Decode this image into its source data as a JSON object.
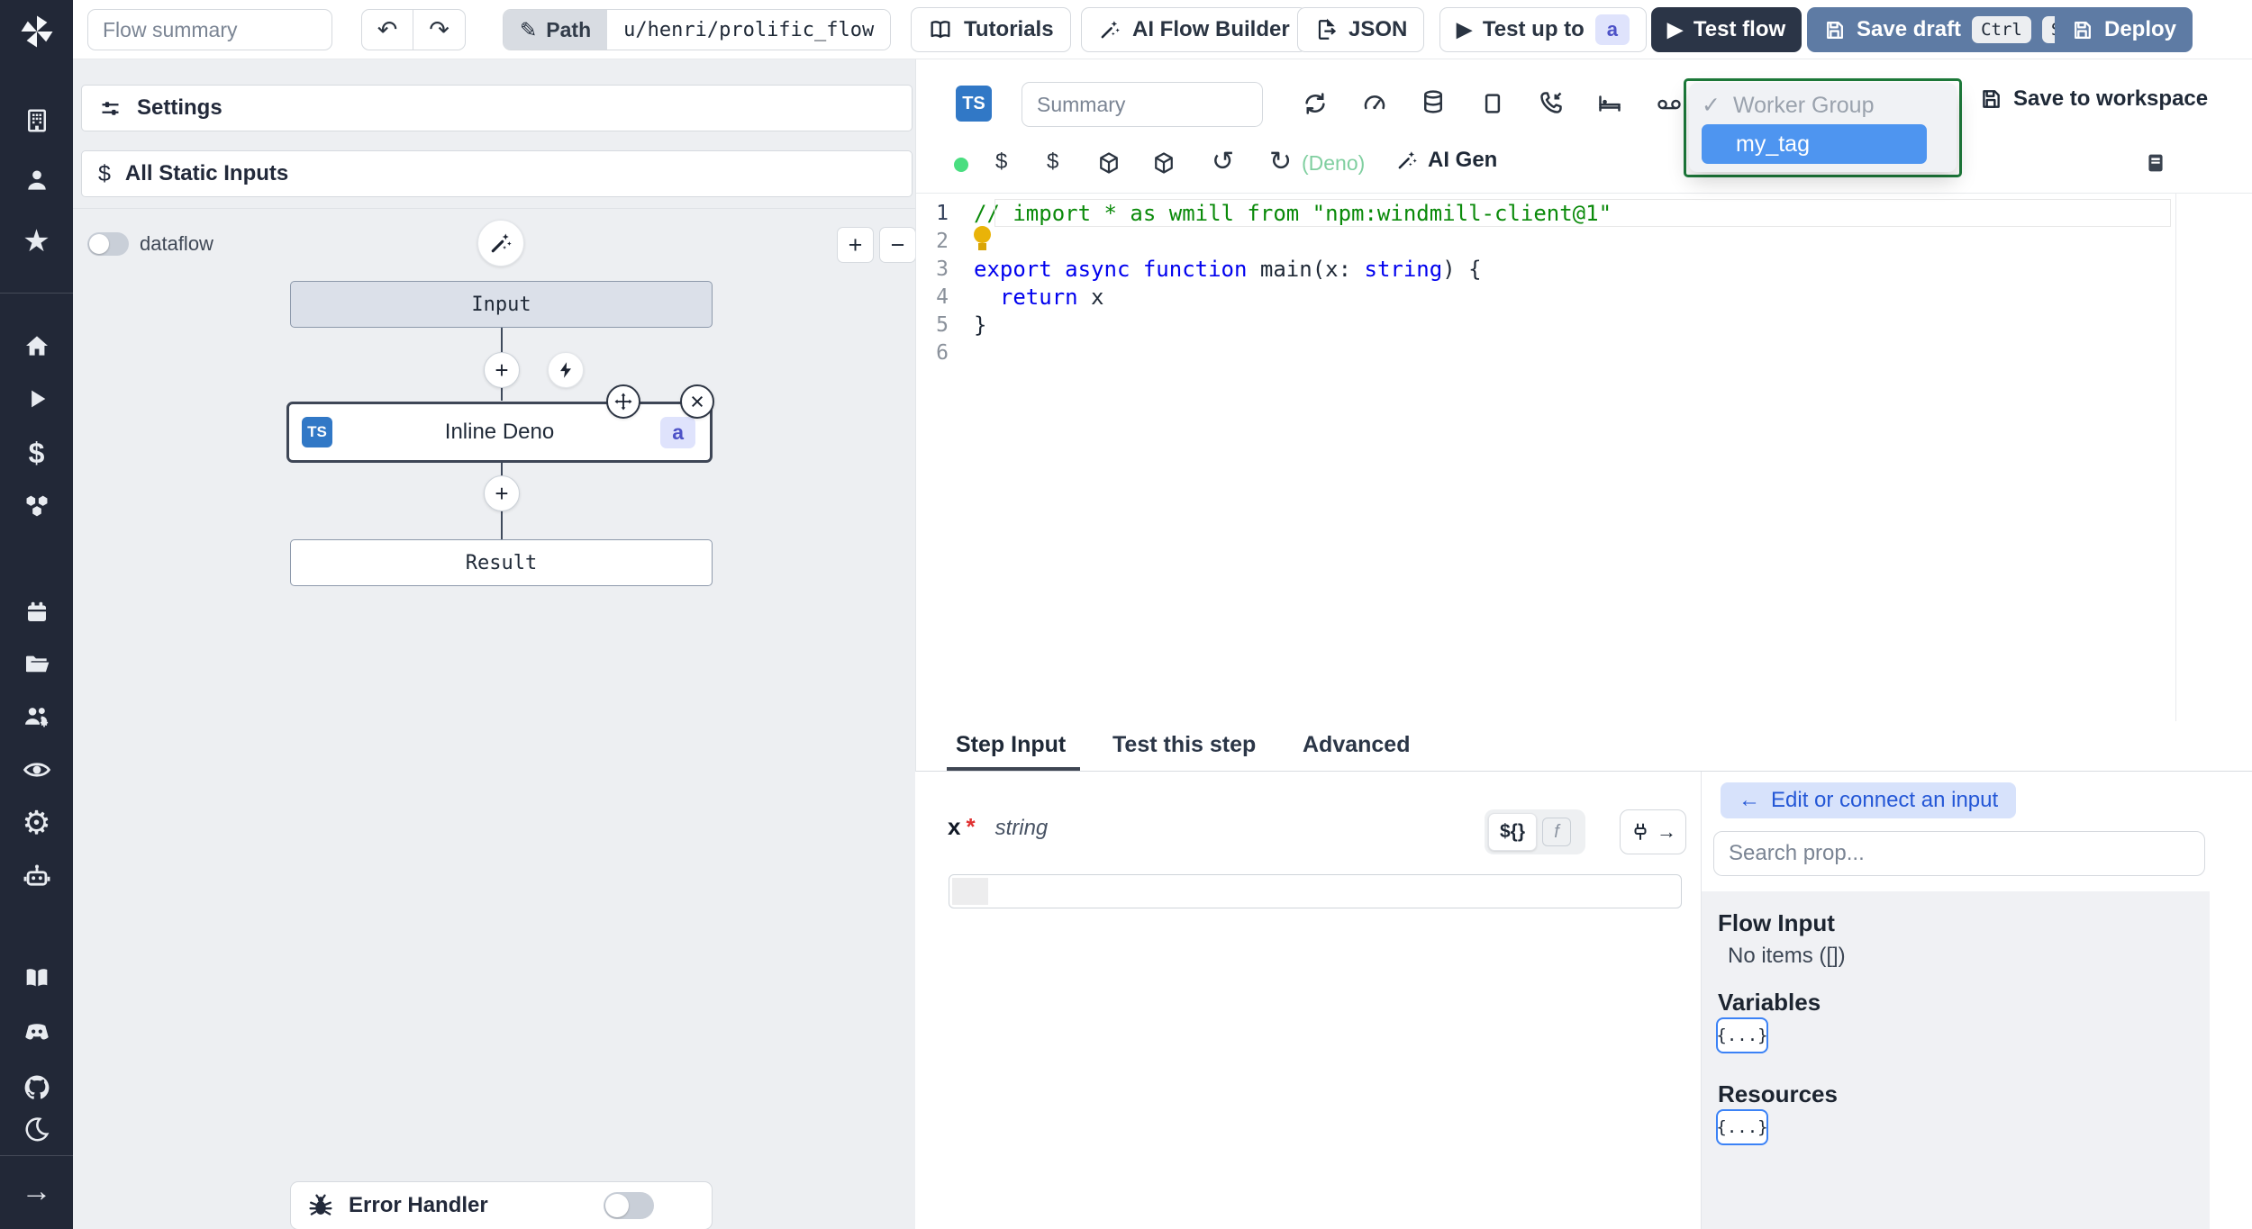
{
  "topbar": {
    "flow_summary_placeholder": "Flow summary",
    "path_label": "Path",
    "path_value": "u/henri/prolific_flow",
    "tutorials_label": "Tutorials",
    "ai_flow_builder_label": "AI Flow Builder",
    "json_label": "JSON",
    "test_up_to_label": "Test up to",
    "test_up_to_badge": "a",
    "test_flow_label": "Test flow",
    "save_draft_label": "Save draft",
    "kbd_ctrl": "Ctrl",
    "kbd_s": "S",
    "deploy_label": "Deploy"
  },
  "sidebar": {
    "icon_names": [
      "windmill-logo",
      "workspace-building",
      "user",
      "favorites-star",
      "home",
      "runs-play",
      "variables-dollar",
      "resources-cubes",
      "schedules-calendar",
      "folders",
      "groups-users-gear",
      "audit-eye",
      "settings-gear",
      "ai-robot",
      "docs-book",
      "discord",
      "github",
      "dark-mode-moon",
      "collapse-arrow"
    ]
  },
  "flow_panel": {
    "settings_label": "Settings",
    "static_inputs_label": "All Static Inputs",
    "static_inputs_icon": "$",
    "dataflow_label": "dataflow",
    "zoom_in": "+",
    "zoom_out": "−",
    "error_handler_label": "Error Handler"
  },
  "graph": {
    "input_node": "Input",
    "step_node": {
      "lang_badge": "TS",
      "title": "Inline Deno",
      "tag_badge": "a"
    },
    "result_node": "Result",
    "plus": "+",
    "close": "×"
  },
  "editor": {
    "lang_badge": "TS",
    "summary_placeholder": "Summary",
    "deno_label": "(Deno)",
    "ai_gen_label": "AI Gen",
    "save_to_workspace_label": "Save to workspace",
    "dollar_icon": "$",
    "history_icon": "↺",
    "refresh_icon": "↻",
    "dropdown": {
      "check": "✓",
      "group_label": "Worker Group",
      "selected": "my_tag"
    },
    "code": {
      "lines": [
        {
          "ln": "1",
          "active": true,
          "tokens": [
            {
              "c": "comment",
              "s": "// import * as wmill from \"npm:windmill-client@1\""
            }
          ]
        },
        {
          "ln": "2",
          "bulb": true,
          "tokens": []
        },
        {
          "ln": "3",
          "tokens": [
            {
              "c": "kw",
              "s": "export"
            },
            {
              "c": "plain",
              "s": " "
            },
            {
              "c": "kw",
              "s": "async"
            },
            {
              "c": "plain",
              "s": " "
            },
            {
              "c": "kw",
              "s": "function"
            },
            {
              "c": "plain",
              "s": " main(x: "
            },
            {
              "c": "type",
              "s": "string"
            },
            {
              "c": "plain",
              "s": ") {"
            }
          ]
        },
        {
          "ln": "4",
          "tokens": [
            {
              "c": "plain",
              "s": "  "
            },
            {
              "c": "kw",
              "s": "return"
            },
            {
              "c": "plain",
              "s": " x"
            }
          ]
        },
        {
          "ln": "5",
          "tokens": [
            {
              "c": "plain",
              "s": "}"
            }
          ]
        },
        {
          "ln": "6",
          "tokens": []
        }
      ]
    }
  },
  "tabs": {
    "items": [
      {
        "label": "Step Input"
      },
      {
        "label": "Test this step"
      },
      {
        "label": "Advanced"
      }
    ],
    "active": "Step Input"
  },
  "step_input": {
    "field_name": "x",
    "required_mark": "*",
    "field_type": "string",
    "expr_toggle": "${}",
    "fn_toggle": "f",
    "connect_arrow": "→"
  },
  "right_panel": {
    "back_arrow": "←",
    "edit_connect_label": "Edit or connect an input",
    "search_placeholder": "Search prop...",
    "flow_input_label": "Flow Input",
    "no_items_label": "No items ([])",
    "variables_label": "Variables",
    "resources_label": "Resources",
    "braces_chip": "{...}"
  },
  "icons_unicode": {
    "undo": "↶",
    "redo": "↷",
    "pencil": "✎",
    "play": "▶",
    "star": "★",
    "home": "⌂",
    "gear": "⚙",
    "dollar": "$",
    "arrow_right": "→",
    "minus": "−",
    "plus": "+",
    "close": "×"
  },
  "colors": {
    "sidebar_bg": "#222837",
    "accent_dark_button": "#2b3547",
    "steel_blue_button": "#5e7ba4",
    "ts_badge_blue": "#3178c6",
    "tag_badge_bg": "#dfe3fc",
    "tag_badge_text": "#4d52c7",
    "selected_option_blue": "#4e95f0",
    "dropdown_border_green": "#1d7a3a",
    "comment_green": "#0a8a0a",
    "keyword_blue": "#0000ee",
    "run_dot_green": "#4ade80",
    "deno_green": "#80cfa0",
    "edit_connect_bg": "#d7e2fb",
    "edit_connect_text": "#2457d6",
    "chip_border_blue": "#3b82f6",
    "required_red": "#e03131"
  }
}
